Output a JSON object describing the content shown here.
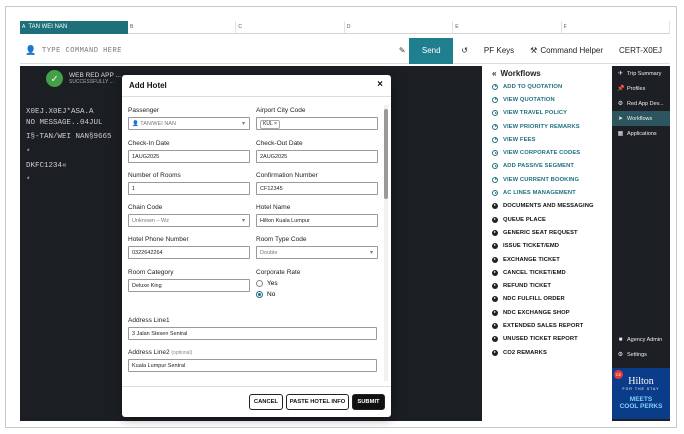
{
  "tabs": [
    {
      "letter": "A",
      "name": "TAN WEI NAN",
      "active": true
    },
    {
      "letter": "B",
      "name": ""
    },
    {
      "letter": "C",
      "name": ""
    },
    {
      "letter": "D",
      "name": ""
    },
    {
      "letter": "E",
      "name": ""
    },
    {
      "letter": "F",
      "name": ""
    }
  ],
  "command": {
    "placeholder": "TYPE COMMAND HERE",
    "send": "Send",
    "pf_keys": "PF Keys",
    "helper": "Command Helper",
    "cert": "CERT-X0EJ"
  },
  "terminal": {
    "banner_title": "WEB RED APP ...",
    "banner_sub": "SUCCESSFULLY ...",
    "lines": [
      "X0EJ.X0EJ*ASA.A",
      "NO MESSAGE..04JUL",
      "I§-TAN/WEI NAN§9665",
      "*",
      "DKFC1234«",
      "*"
    ]
  },
  "modal": {
    "title": "Add Hotel",
    "close": "×",
    "fields": {
      "passenger": {
        "label": "Passenger",
        "value": "TAN/WEI NAN"
      },
      "airport": {
        "label": "Airport City Code",
        "value": "KUL"
      },
      "checkin": {
        "label": "Check-In Date",
        "value": "1AUG2025"
      },
      "checkout": {
        "label": "Check-Out Date",
        "value": "2AUG2025"
      },
      "rooms": {
        "label": "Number of Rooms",
        "value": "1"
      },
      "confirmation": {
        "label": "Confirmation Number",
        "value": "CF12345"
      },
      "chain": {
        "label": "Chain Code",
        "value": "Unknown – Wz"
      },
      "hotel_name": {
        "label": "Hotel Name",
        "value": "Hilton Kuala Lumpur"
      },
      "phone": {
        "label": "Hotel Phone Number",
        "value": "0322642264"
      },
      "room_type": {
        "label": "Room Type Code",
        "value": "Double"
      },
      "room_category": {
        "label": "Room Category",
        "value": "Deluxe King"
      },
      "corporate": {
        "label": "Corporate Rate",
        "yes": "Yes",
        "no": "No",
        "selected": "No"
      },
      "address1": {
        "label": "Address Line1",
        "value": "3 Jalan Stesen Sentral"
      },
      "address2": {
        "label": "Address Line2",
        "optional": "(optional)",
        "value": "Kuala Lumpur Sentral"
      }
    },
    "buttons": {
      "cancel": "CANCEL",
      "paste": "PASTE HOTEL INFO",
      "submit": "SUBMIT"
    }
  },
  "workflows": {
    "title": "Workflows",
    "items": [
      {
        "label": "ADD TO QUOTATION",
        "style": "link"
      },
      {
        "label": "VIEW QUOTATION",
        "style": "link"
      },
      {
        "label": "VIEW TRAVEL POLICY",
        "style": "link"
      },
      {
        "label": "VIEW PRIORITY REMARKS",
        "style": "link"
      },
      {
        "label": "VIEW FEES",
        "style": "link"
      },
      {
        "label": "VIEW CORPORATE CODES",
        "style": "link"
      },
      {
        "label": "ADD PASSIVE SEGMENT",
        "style": "link"
      },
      {
        "label": "VIEW CURRENT BOOKING",
        "style": "link"
      },
      {
        "label": "AC LINES MANAGEMENT",
        "style": "link"
      },
      {
        "label": "DOCUMENTS AND MESSAGING",
        "style": "dark"
      },
      {
        "label": "QUEUE PLACE",
        "style": "dark"
      },
      {
        "label": "GENERIC SEAT REQUEST",
        "style": "dark"
      },
      {
        "label": "ISSUE TICKET/EMD",
        "style": "dark"
      },
      {
        "label": "EXCHANGE TICKET",
        "style": "dark"
      },
      {
        "label": "CANCEL TICKET/EMD",
        "style": "dark"
      },
      {
        "label": "REFUND TICKET",
        "style": "dark"
      },
      {
        "label": "NDC FULFILL ORDER",
        "style": "dark"
      },
      {
        "label": "NDC EXCHANGE SHOP",
        "style": "dark"
      },
      {
        "label": "EXTENDED SALES REPORT",
        "style": "dark"
      },
      {
        "label": "UNUSED TICKET REPORT",
        "style": "dark"
      },
      {
        "label": "CO2 REMARKS",
        "style": "dark"
      }
    ]
  },
  "rail": {
    "items": [
      {
        "label": "Trip Summary",
        "icon": "trip-icon"
      },
      {
        "label": "Profiles",
        "icon": "pin-icon"
      },
      {
        "label": "Red App Dev...",
        "icon": "app-icon"
      },
      {
        "label": "Workflows",
        "icon": "workflow-icon",
        "active": true
      },
      {
        "label": "Applications",
        "icon": "grid-icon"
      }
    ],
    "bottom": [
      {
        "label": "Agency Admin",
        "icon": "admin-icon"
      },
      {
        "label": "Settings",
        "icon": "gear-icon"
      }
    ],
    "ad": {
      "logo": "Hilton",
      "sub": "FOR THE STAY",
      "line1": "MEETS",
      "line2": "COOL PERKS",
      "badge": "CE"
    }
  },
  "colors": {
    "accent": "#1f7f8f",
    "terminal_bg": "#1b1e23",
    "link": "#1d6f80"
  }
}
